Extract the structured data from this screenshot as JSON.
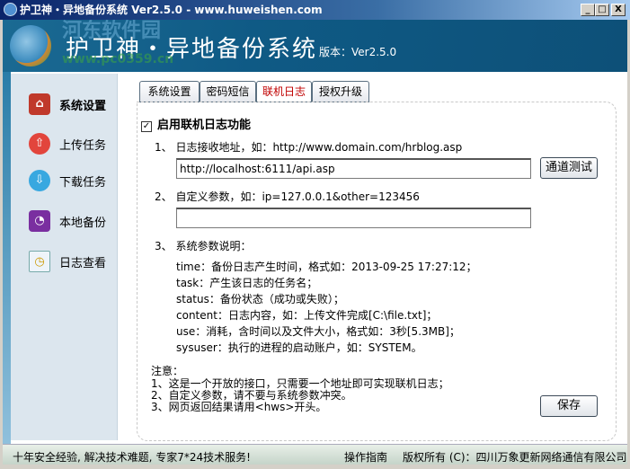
{
  "window": {
    "title": "护卫神・异地备份系统 Ver2.5.0 - www.huweishen.com",
    "controls": [
      "_",
      "□",
      "X"
    ]
  },
  "header": {
    "app_name": "护卫神・异地备份系统",
    "version": "版本：Ver2.5.0",
    "watermark": "河东软件园",
    "watermark_url": "www.pc0359.cn"
  },
  "sidebar": {
    "items": [
      {
        "label": "系统设置",
        "icon": "home-icon",
        "active": true
      },
      {
        "label": "上传任务",
        "icon": "upload-icon"
      },
      {
        "label": "下载任务",
        "icon": "download-icon"
      },
      {
        "label": "本地备份",
        "icon": "local-backup-icon"
      },
      {
        "label": "日志查看",
        "icon": "log-icon"
      }
    ]
  },
  "tabs": [
    {
      "label": "系统设置"
    },
    {
      "label": "密码短信"
    },
    {
      "label": "联机日志",
      "active": true
    },
    {
      "label": "授权升级"
    }
  ],
  "panel": {
    "enable_label": "启用联机日志功能",
    "enable_checked": true,
    "item1": "1、 日志接收地址，如：http://www.domain.com/hrblog.asp",
    "url_value": "http://localhost:6111/api.asp",
    "test_button": "通道测试",
    "item2": "2、 自定义参数，如：ip=127.0.0.1&other=123456",
    "param_value": "",
    "item3": "3、 系统参数说明：",
    "params": [
      "time：备份日志产生时间，格式如：2013-09-25 17:27:12；",
      "task：产生该日志的任务名；",
      "status：备份状态（成功或失败）；",
      "content：日志内容，如：上传文件完成[C:\\file.txt]；",
      "use：消耗，含时间以及文件大小，格式如：3秒[5.3MB]；",
      "sysuser：执行的进程的启动账户，如：SYSTEM。"
    ],
    "note_title": "注意：",
    "notes": [
      "1、这是一个开放的接口，只需要一个地址即可实现联机日志；",
      "2、自定义参数，请不要与系统参数冲突。",
      "3、网页返回结果请用<hws>开头。"
    ],
    "save_button": "保存"
  },
  "status": {
    "slogan": "十年安全经验, 解决技术难题, 专家7*24技术服务!",
    "guide": "操作指南",
    "copyright": "版权所有 (C)：四川万象更新网络通信有限公司"
  }
}
